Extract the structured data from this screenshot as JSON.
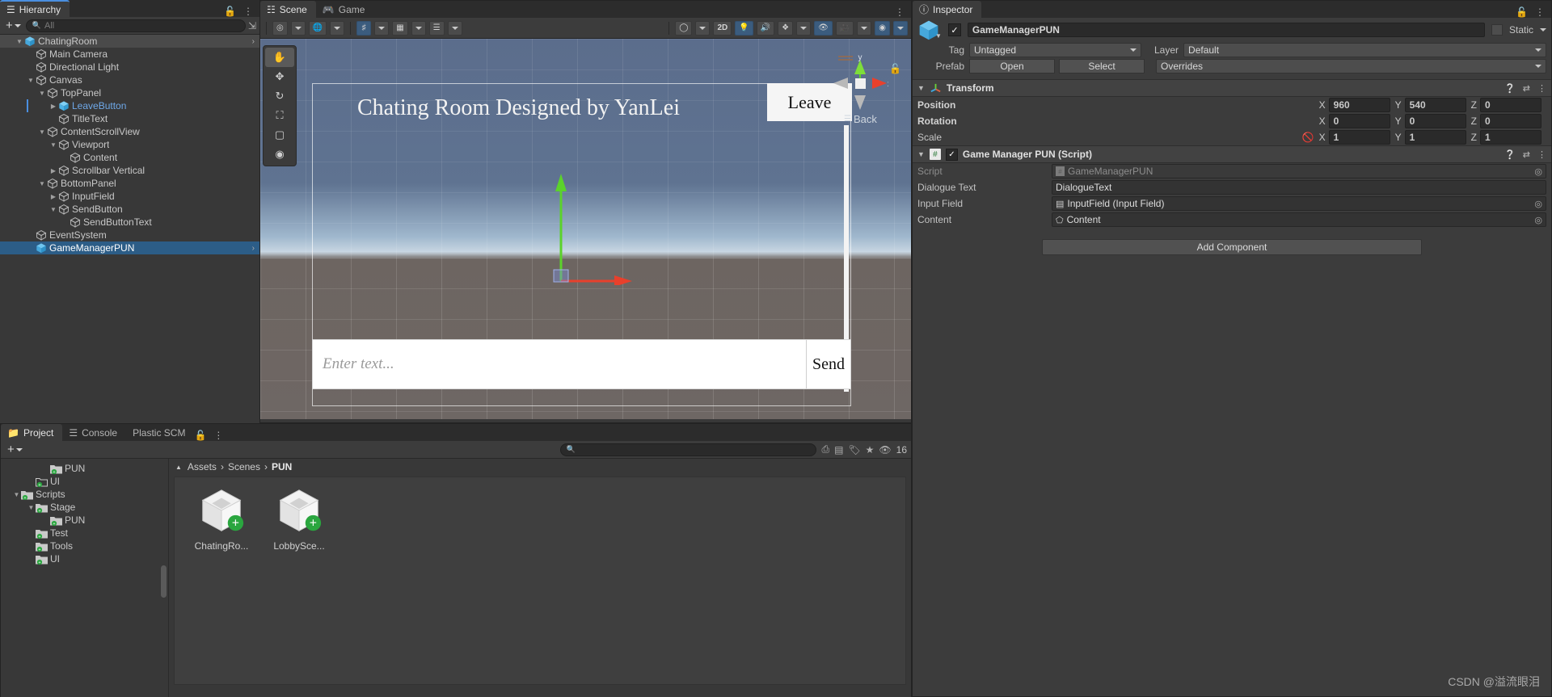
{
  "hierarchy": {
    "tab_label": "Hierarchy",
    "search_placeholder": "All",
    "add_label": "+",
    "rows": [
      {
        "label": "ChatingRoom",
        "depth": 1,
        "arrow": "down",
        "type": "prefab-root",
        "state": "root"
      },
      {
        "label": "Main Camera",
        "depth": 2,
        "arrow": "none",
        "type": "go",
        "state": "normal"
      },
      {
        "label": "Directional Light",
        "depth": 2,
        "arrow": "none",
        "type": "go",
        "state": "normal"
      },
      {
        "label": "Canvas",
        "depth": 2,
        "arrow": "down",
        "type": "go",
        "state": "normal"
      },
      {
        "label": "TopPanel",
        "depth": 3,
        "arrow": "down",
        "type": "go",
        "state": "normal"
      },
      {
        "label": "LeaveButton",
        "depth": 4,
        "arrow": "right",
        "type": "go-blue",
        "state": "blue"
      },
      {
        "label": "TitleText",
        "depth": 4,
        "arrow": "none",
        "type": "go",
        "state": "normal"
      },
      {
        "label": "ContentScrollView",
        "depth": 3,
        "arrow": "down",
        "type": "go",
        "state": "normal"
      },
      {
        "label": "Viewport",
        "depth": 4,
        "arrow": "down",
        "type": "go",
        "state": "normal"
      },
      {
        "label": "Content",
        "depth": 5,
        "arrow": "none",
        "type": "go",
        "state": "normal"
      },
      {
        "label": "Scrollbar Vertical",
        "depth": 4,
        "arrow": "right",
        "type": "go",
        "state": "normal"
      },
      {
        "label": "BottomPanel",
        "depth": 3,
        "arrow": "down",
        "type": "go",
        "state": "normal"
      },
      {
        "label": "InputField",
        "depth": 4,
        "arrow": "right",
        "type": "go",
        "state": "normal"
      },
      {
        "label": "SendButton",
        "depth": 4,
        "arrow": "down",
        "type": "go",
        "state": "normal"
      },
      {
        "label": "SendButtonText",
        "depth": 5,
        "arrow": "none",
        "type": "go",
        "state": "normal"
      },
      {
        "label": "EventSystem",
        "depth": 2,
        "arrow": "none",
        "type": "go",
        "state": "normal"
      },
      {
        "label": "GameManagerPUN",
        "depth": 2,
        "arrow": "none",
        "type": "prefab",
        "state": "selected"
      }
    ]
  },
  "scene": {
    "tabs": [
      {
        "label": "Scene",
        "icon": "grid-icon",
        "active": true
      },
      {
        "label": "Game",
        "icon": "gamepad-icon",
        "active": false
      }
    ],
    "toolbar": {
      "pivot_label": "",
      "twod_label": "2D",
      "shading_label": "",
      "grid_label": ""
    },
    "tools": [
      "hand-tool",
      "move-tool",
      "rotate-tool",
      "rect-tool",
      "transform-tool"
    ],
    "content": {
      "title": "Chating Room Designed by YanLei",
      "leave_button": "Leave",
      "back_label": "Back",
      "input_placeholder": "Enter text...",
      "send_button": "Send"
    },
    "gizmo": {
      "y_label": "y",
      "x_label": "x"
    }
  },
  "inspector": {
    "tab_label": "Inspector",
    "object_name": "GameManagerPUN",
    "enabled": true,
    "static_label": "Static",
    "tag_label": "Tag",
    "tag_value": "Untagged",
    "layer_label": "Layer",
    "layer_value": "Default",
    "prefab_label": "Prefab",
    "prefab_open": "Open",
    "prefab_select": "Select",
    "prefab_overrides": "Overrides",
    "transform": {
      "title": "Transform",
      "rows": [
        {
          "name": "Position",
          "x": "960",
          "y": "540",
          "z": "0"
        },
        {
          "name": "Rotation",
          "x": "0",
          "y": "0",
          "z": "0"
        },
        {
          "name": "Scale",
          "x": "1",
          "y": "1",
          "z": "1"
        }
      ],
      "axis_labels": [
        "X",
        "Y",
        "Z"
      ]
    },
    "script_component": {
      "title": "Game Manager PUN (Script)",
      "enabled": true,
      "fields": [
        {
          "label": "Script",
          "value": "GameManagerPUN",
          "icon": "script-icon",
          "disabled": true,
          "has_target": true
        },
        {
          "label": "Dialogue Text",
          "value": "DialogueText",
          "icon": "none",
          "disabled": false,
          "has_target": false
        },
        {
          "label": "Input Field",
          "value": "InputField (Input Field)",
          "icon": "inputfield-icon",
          "disabled": false,
          "has_target": true
        },
        {
          "label": "Content",
          "value": "Content",
          "icon": "cube-icon",
          "disabled": false,
          "has_target": true
        }
      ]
    },
    "add_component_label": "Add Component"
  },
  "project": {
    "tabs": [
      {
        "label": "Project",
        "icon": "folder-icon",
        "active": true
      },
      {
        "label": "Console",
        "icon": "console-icon",
        "active": false
      },
      {
        "label": "Plastic SCM",
        "icon": "none",
        "active": false
      }
    ],
    "add_label": "+",
    "search_placeholder": "",
    "item_count": "16",
    "breadcrumb": [
      "Assets",
      "Scenes",
      "PUN"
    ],
    "folders": [
      {
        "label": "PUN",
        "depth": 3,
        "arrow": "none"
      },
      {
        "label": "UI",
        "depth": 2,
        "arrow": "none",
        "empty": true
      },
      {
        "label": "Scripts",
        "depth": 1,
        "arrow": "down"
      },
      {
        "label": "Stage",
        "depth": 2,
        "arrow": "down"
      },
      {
        "label": "PUN",
        "depth": 3,
        "arrow": "none"
      },
      {
        "label": "Test",
        "depth": 2,
        "arrow": "none"
      },
      {
        "label": "Tools",
        "depth": 2,
        "arrow": "none"
      },
      {
        "label": "UI",
        "depth": 2,
        "arrow": "none"
      }
    ],
    "assets": [
      {
        "name": "ChatingRo...",
        "type": "scene"
      },
      {
        "name": "LobbySce...",
        "type": "scene"
      }
    ]
  },
  "watermark": "CSDN @溢流眼泪",
  "colors": {
    "accent_blue": "#2c5d87",
    "prefab_blue": "#6ea8e8",
    "panel_bg": "#383838",
    "header_bg": "#3c3c3c",
    "green_add": "#2aa63f"
  }
}
